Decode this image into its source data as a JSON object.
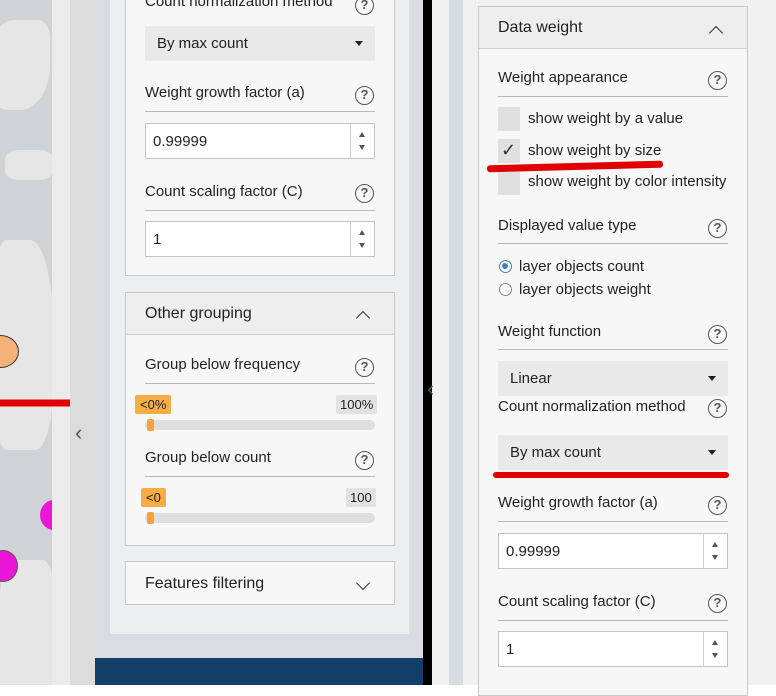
{
  "left_panel": {
    "top_card": {
      "partial_label": "Count normalization method",
      "count_norm_value": "By max count",
      "weight_growth_label": "Weight growth factor (a)",
      "weight_growth_value": "0.99999",
      "count_scaling_label": "Count scaling factor (C)",
      "count_scaling_value": "1"
    },
    "other_grouping": {
      "title": "Other grouping",
      "freq_label": "Group below frequency",
      "freq_value_label": "<0%",
      "freq_max_label": "100%",
      "freq_value": 0,
      "count_label": "Group below count",
      "count_value_label": "<0",
      "count_max_label": "100",
      "count_value": 0
    },
    "features_filtering": {
      "title": "Features filtering"
    }
  },
  "right_panel": {
    "card_title": "Data weight",
    "weight_appearance": {
      "label": "Weight appearance",
      "options": [
        {
          "label": "show weight by a value",
          "checked": false
        },
        {
          "label": "show weight by size",
          "checked": true
        },
        {
          "label": "show weight by color intensity",
          "checked": false
        }
      ]
    },
    "displayed_value_type": {
      "label": "Displayed value type",
      "options": [
        {
          "label": "layer objects count",
          "selected": true
        },
        {
          "label": "layer objects weight",
          "selected": false
        }
      ]
    },
    "weight_function": {
      "label": "Weight function",
      "value": "Linear"
    },
    "count_normalization": {
      "label": "Count normalization method",
      "value": "By max count"
    },
    "weight_growth": {
      "label": "Weight growth factor (a)",
      "value": "0.99999"
    },
    "count_scaling": {
      "label": "Count scaling factor (C)",
      "value": "1"
    }
  },
  "icons": {
    "help": "?",
    "checkmark": "✓"
  },
  "colors": {
    "accent_orange": "#f6ad45",
    "annotation_red": "#e00000",
    "radio_blue": "#3b82c4",
    "footer_navy": "#133e68"
  }
}
